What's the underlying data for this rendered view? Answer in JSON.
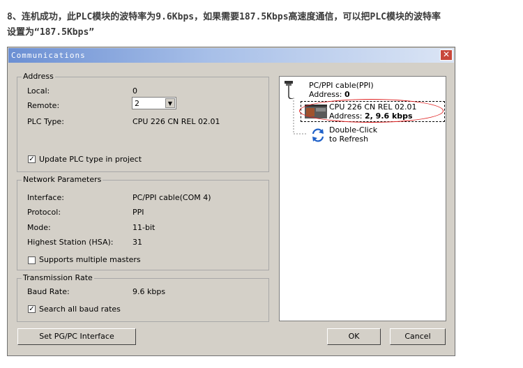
{
  "caption": {
    "line1": "8、连机成功，此PLC模块的波特率为9.6Kbps，如果需要187.5Kbps高速度通信，可以把PLC模块的波特率",
    "line2": "设置为“187.5Kbps”"
  },
  "window": {
    "title": "Communications",
    "close_glyph": "✕"
  },
  "address": {
    "legend": "Address",
    "local_label": "Local:",
    "local_value": "0",
    "remote_label": "Remote:",
    "remote_value": "2",
    "plc_type_label": "PLC Type:",
    "plc_type_value": "CPU 226 CN REL 02.01",
    "update_label": "Update PLC type in project",
    "update_checked": true
  },
  "network": {
    "legend": "Network Parameters",
    "interface_label": "Interface:",
    "interface_value": "PC/PPI cable(COM 4)",
    "protocol_label": "Protocol:",
    "protocol_value": "PPI",
    "mode_label": "Mode:",
    "mode_value": "11-bit",
    "hsa_label": "Highest Station (HSA):",
    "hsa_value": "31",
    "multi_label": "Supports multiple masters",
    "multi_checked": false
  },
  "transmission": {
    "legend": "Transmission Rate",
    "baud_label": "Baud Rate:",
    "baud_value": "9.6 kbps",
    "search_label": "Search all baud rates",
    "search_checked": true
  },
  "tree": {
    "cable_line1": "PC/PPI cable(PPI)",
    "cable_addr_prefix": "Address: ",
    "cable_addr_value": "0",
    "cpu_line1": "CPU 226 CN REL 02.01",
    "cpu_addr_prefix": "Address: ",
    "cpu_addr_value": "2, 9.6 kbps",
    "refresh_line1": "Double-Click",
    "refresh_line2": "to Refresh"
  },
  "buttons": {
    "set_pgpc": "Set PG/PC Interface",
    "ok": "OK",
    "cancel": "Cancel"
  },
  "icons": {
    "check": "✓",
    "dropdown": "▼"
  },
  "colors": {
    "title_bar_start": "#6b8fd3",
    "close_button": "#c8483b",
    "highlight_ellipse": "#e02020"
  }
}
